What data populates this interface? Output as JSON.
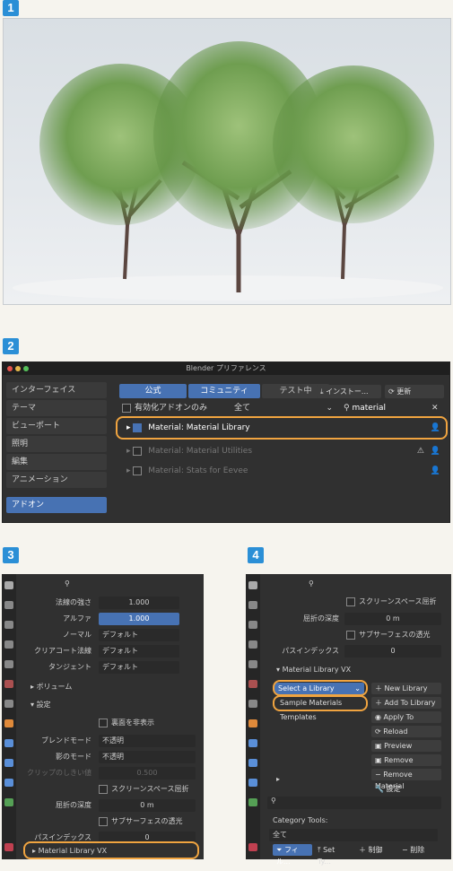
{
  "steps": [
    "1",
    "2",
    "3",
    "4"
  ],
  "prefs": {
    "title": "Blender プリファレンス",
    "sidebar": [
      "インターフェイス",
      "テーマ",
      "ビューポート",
      "照明",
      "編集",
      "アニメーション"
    ],
    "sidebar_active": "アドオン",
    "tabs": [
      "公式",
      "コミュニティ",
      "テスト中"
    ],
    "install": "インストー...",
    "refresh": "更新",
    "enabled_only": "有効化アドオンのみ",
    "category": "全て",
    "search_value": "material",
    "addons": [
      "Material: Material Library",
      "Material: Material Utilities",
      "Material: Stats for Eevee"
    ]
  },
  "panel3": {
    "rows": [
      {
        "label": "法線の強さ",
        "value": "1.000"
      },
      {
        "label": "アルファ",
        "value": "1.000"
      },
      {
        "label": "ノーマル",
        "value": "デフォルト"
      },
      {
        "label": "クリアコート法線",
        "value": "デフォルト"
      },
      {
        "label": "タンジェント",
        "value": "デフォルト"
      }
    ],
    "volume": "ボリューム",
    "settings": "設定",
    "backface": "裏面を非表示",
    "blend_mode_label": "ブレンドモード",
    "blend_mode": "不透明",
    "shadow_mode_label": "影のモード",
    "shadow_mode": "不透明",
    "clip_label": "クリップのしきい値",
    "clip_value": "0.500",
    "screen_space": "スクリーンスペース屈折",
    "refraction_label": "屈折の深度",
    "refraction_value": "0 m",
    "subsurface": "サブサーフェスの透光",
    "pass_label": "パスインデックス",
    "pass_value": "0",
    "library": "Material Library VX"
  },
  "panel4": {
    "screen_space": "スクリーンスペース屈折",
    "refraction_label": "屈折の深度",
    "refraction_value": "0 m",
    "subsurface": "サブサーフェスの透光",
    "pass_label": "パスインデックス",
    "pass_value": "0",
    "library": "Material Library VX",
    "select_library": "Select a Library",
    "sample": "Sample Materials",
    "templates": "Templates",
    "buttons": [
      "New Library",
      "Add To Library",
      "Apply To Selected",
      "Reload Material",
      "Preview Material",
      "Remove Preview",
      "Remove Material",
      "設定"
    ],
    "category_tools": "Category Tools:",
    "category_value": "全て",
    "footer": [
      "フィル...",
      "Set Ty...",
      "制御",
      "削除"
    ]
  },
  "colors": {
    "accent": "#4772b3",
    "highlight": "#f0a440",
    "badge": "#2b8fd6"
  }
}
